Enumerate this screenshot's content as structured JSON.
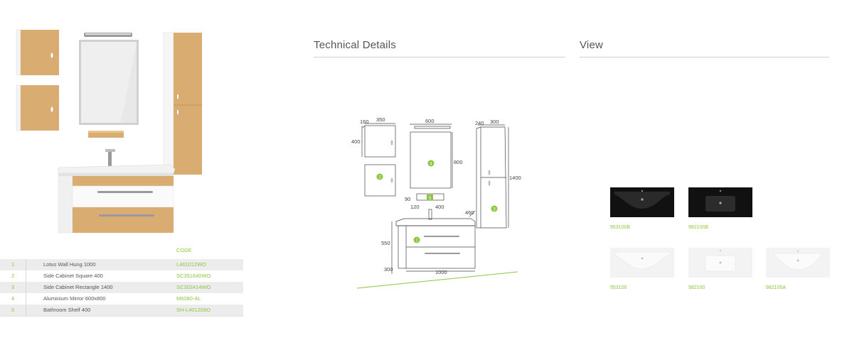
{
  "sections": {
    "technical_title": "Technical Details",
    "view_title": "View"
  },
  "parts_table": {
    "code_header": "CODE",
    "rows": [
      {
        "num": "1",
        "name": "Lotus Wall Hung 1000",
        "code": "L461012WO"
      },
      {
        "num": "2",
        "name": "Side Cabinet Square 400",
        "code": "SC351640WO"
      },
      {
        "num": "3",
        "name": "Side Cabinet Rectangle 1400",
        "code": "SC302414WO"
      },
      {
        "num": "4",
        "name": "Aluminium Mirror 600x800",
        "code": "M6080-AL"
      },
      {
        "num": "5",
        "name": "Bathroom Shelf 400",
        "code": "SH-L401209O"
      }
    ]
  },
  "dimensions": {
    "d160": "160",
    "d350": "350",
    "d400a": "400",
    "d600": "600",
    "d800": "800",
    "d240": "240",
    "d300a": "300",
    "d1400": "1400",
    "d90": "90",
    "d120": "120",
    "d400b": "400",
    "d460": "460",
    "d550": "550",
    "d300b": "300",
    "d1000": "1000"
  },
  "markers": [
    "1",
    "2",
    "3",
    "4",
    "5"
  ],
  "basins": [
    {
      "label": "953100B",
      "finish": "black"
    },
    {
      "label": "982100B",
      "finish": "black"
    },
    {
      "label": "953100",
      "finish": "white"
    },
    {
      "label": "982100",
      "finish": "white"
    },
    {
      "label": "982100A",
      "finish": "white"
    }
  ],
  "colors": {
    "accent": "#8cc63f",
    "wood": "#d9ad72",
    "text": "#444444"
  }
}
